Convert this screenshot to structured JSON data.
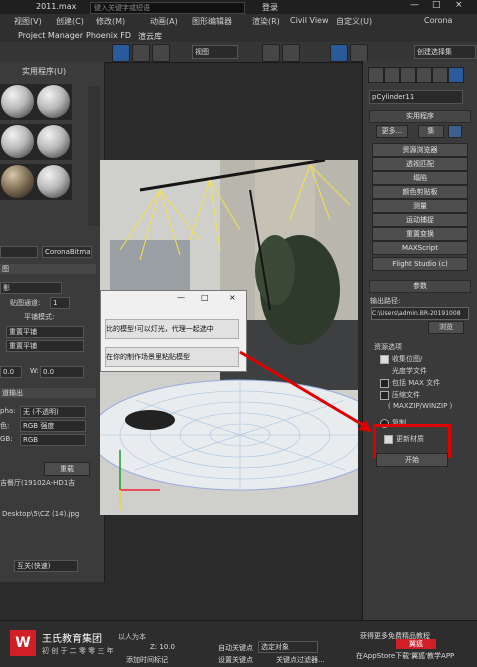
{
  "titlebar": {
    "file": "2011.max",
    "search_placeholder": "键入关键字或短语",
    "login": "登录"
  },
  "menubar": [
    "视图(V)",
    "创建(C)",
    "修改(M)",
    "动画(A)",
    "图形编辑器",
    "渲染(R)",
    "Civil View",
    "自定义(U)",
    "Corona",
    "Project Manager",
    "Phoenix FD",
    "渲云库"
  ],
  "toolbar": {
    "view_dropdown": "视图",
    "selection_set": "创建选择集"
  },
  "material_editor": {
    "tabs": [
      "实用程序(U)"
    ],
    "map_type": "CoronaBitmap",
    "section_title": "图",
    "map_channel_label": "贴图通道:",
    "map_channel_value": "1",
    "tiling_mode_label": "平铺模式:",
    "tiling_u": "重置平铺",
    "tiling_v": "重置平铺",
    "w_label": "W:",
    "w_value": "0.0",
    "v_value": "0.0",
    "output_title": "道输出",
    "alpha_label": "pha:",
    "alpha_value": "无 (不透明)",
    "color_label": "色:",
    "color_value": "RGB 强度",
    "rgb_label": "GB:",
    "rgb_value": "RGB",
    "reload_button": "重载",
    "path1": "吉餐厅(19102A-HD1吉",
    "path2": "Desktop\\5\\CZ (14).jpg",
    "bottom_value": "互关(快速)"
  },
  "dialog": {
    "title_buttons": [
      "—",
      "□",
      "×"
    ],
    "button1": "比的模型!可以灯光，代理一起选中",
    "button2": "在你的制作场景里粘贴模型"
  },
  "command_panel": {
    "object_name": "pCylinder11",
    "utilities_title": "实用程序",
    "more_button": "更多...",
    "sets_button": "集",
    "utilities": [
      "资源浏览器",
      "透视匹配",
      "塌陷",
      "颜色剪贴板",
      "测量",
      "运动捕捉",
      "重置变换",
      "MAXScript",
      "Flight Studio (c)"
    ],
    "params_title": "参数",
    "output_path_label": "输出路径:",
    "output_path_value": "C:\\Users\\admin.BR-20191008",
    "browse_button": "浏览",
    "resource_options_label": "资源选项",
    "collect_maps_label": "收集位图/",
    "photometric_label": "光度学文件",
    "include_max_label": "包括 MAX 文件",
    "compress_label": "压缩文件",
    "maxzip_label": "( MAXZIP/WINZIP )",
    "copy_label": "复制",
    "update_material_label": "更新材质",
    "start_button": "开始"
  },
  "bottom": {
    "logo_char": "W",
    "company": "王氏教育集团",
    "slogan": "以人为本",
    "tagline": "初 创 于 二 零 零 三 年",
    "auto_key": "自动关键点",
    "selected_object": "选定对象",
    "set_key": "设置关键点",
    "key_filter": "关键点过滤器...",
    "add_time_tag": "添加时间标记",
    "z_value": "Z: 10.0",
    "promo": "获得更多免费精品教程",
    "app_promo": "在AppStore下载'翼狐'教学APP",
    "brand": "翼狐"
  },
  "colors": {
    "accent_blue": "#2a5a9a",
    "highlight_red": "#e00000",
    "logo_red": "#d01f26"
  }
}
